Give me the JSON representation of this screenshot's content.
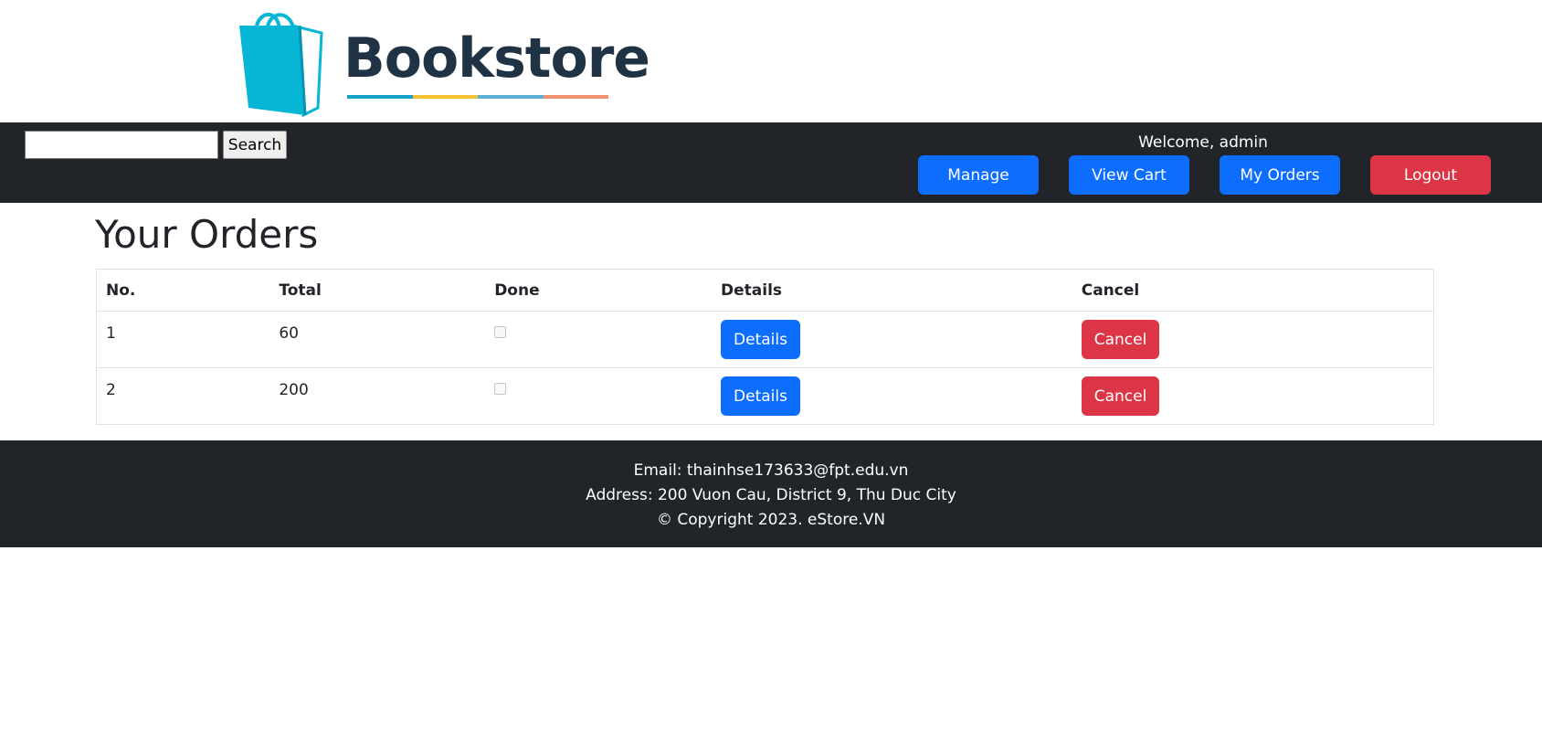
{
  "brand": {
    "name": "Bookstore",
    "icon": "shopping-bag-icon",
    "colors": {
      "bag": "#06b6d4",
      "text": "#1f3344",
      "stripes": [
        "#14a3c7",
        "#f2c233",
        "#5ab0d6",
        "#f29070"
      ]
    }
  },
  "navbar": {
    "search": {
      "value": "",
      "placeholder": "",
      "button_label": "Search"
    },
    "welcome": "Welcome, admin",
    "buttons": {
      "manage": "Manage",
      "view_cart": "View Cart",
      "my_orders": "My Orders",
      "logout": "Logout"
    }
  },
  "main": {
    "title": "Your Orders",
    "table": {
      "headers": {
        "no": "No.",
        "total": "Total",
        "done": "Done",
        "details": "Details",
        "cancel": "Cancel"
      },
      "rows": [
        {
          "no": "1",
          "total": "60",
          "done": false,
          "details_label": "Details",
          "cancel_label": "Cancel"
        },
        {
          "no": "2",
          "total": "200",
          "done": false,
          "details_label": "Details",
          "cancel_label": "Cancel"
        }
      ]
    }
  },
  "footer": {
    "email": "Email: thainhse173633@fpt.edu.vn",
    "address": "Address: 200 Vuon Cau, District 9, Thu Duc City",
    "copyright": "© Copyright 2023. eStore.VN"
  },
  "colors": {
    "primary": "#0d6efd",
    "danger": "#dc3545",
    "dark": "#212529"
  }
}
